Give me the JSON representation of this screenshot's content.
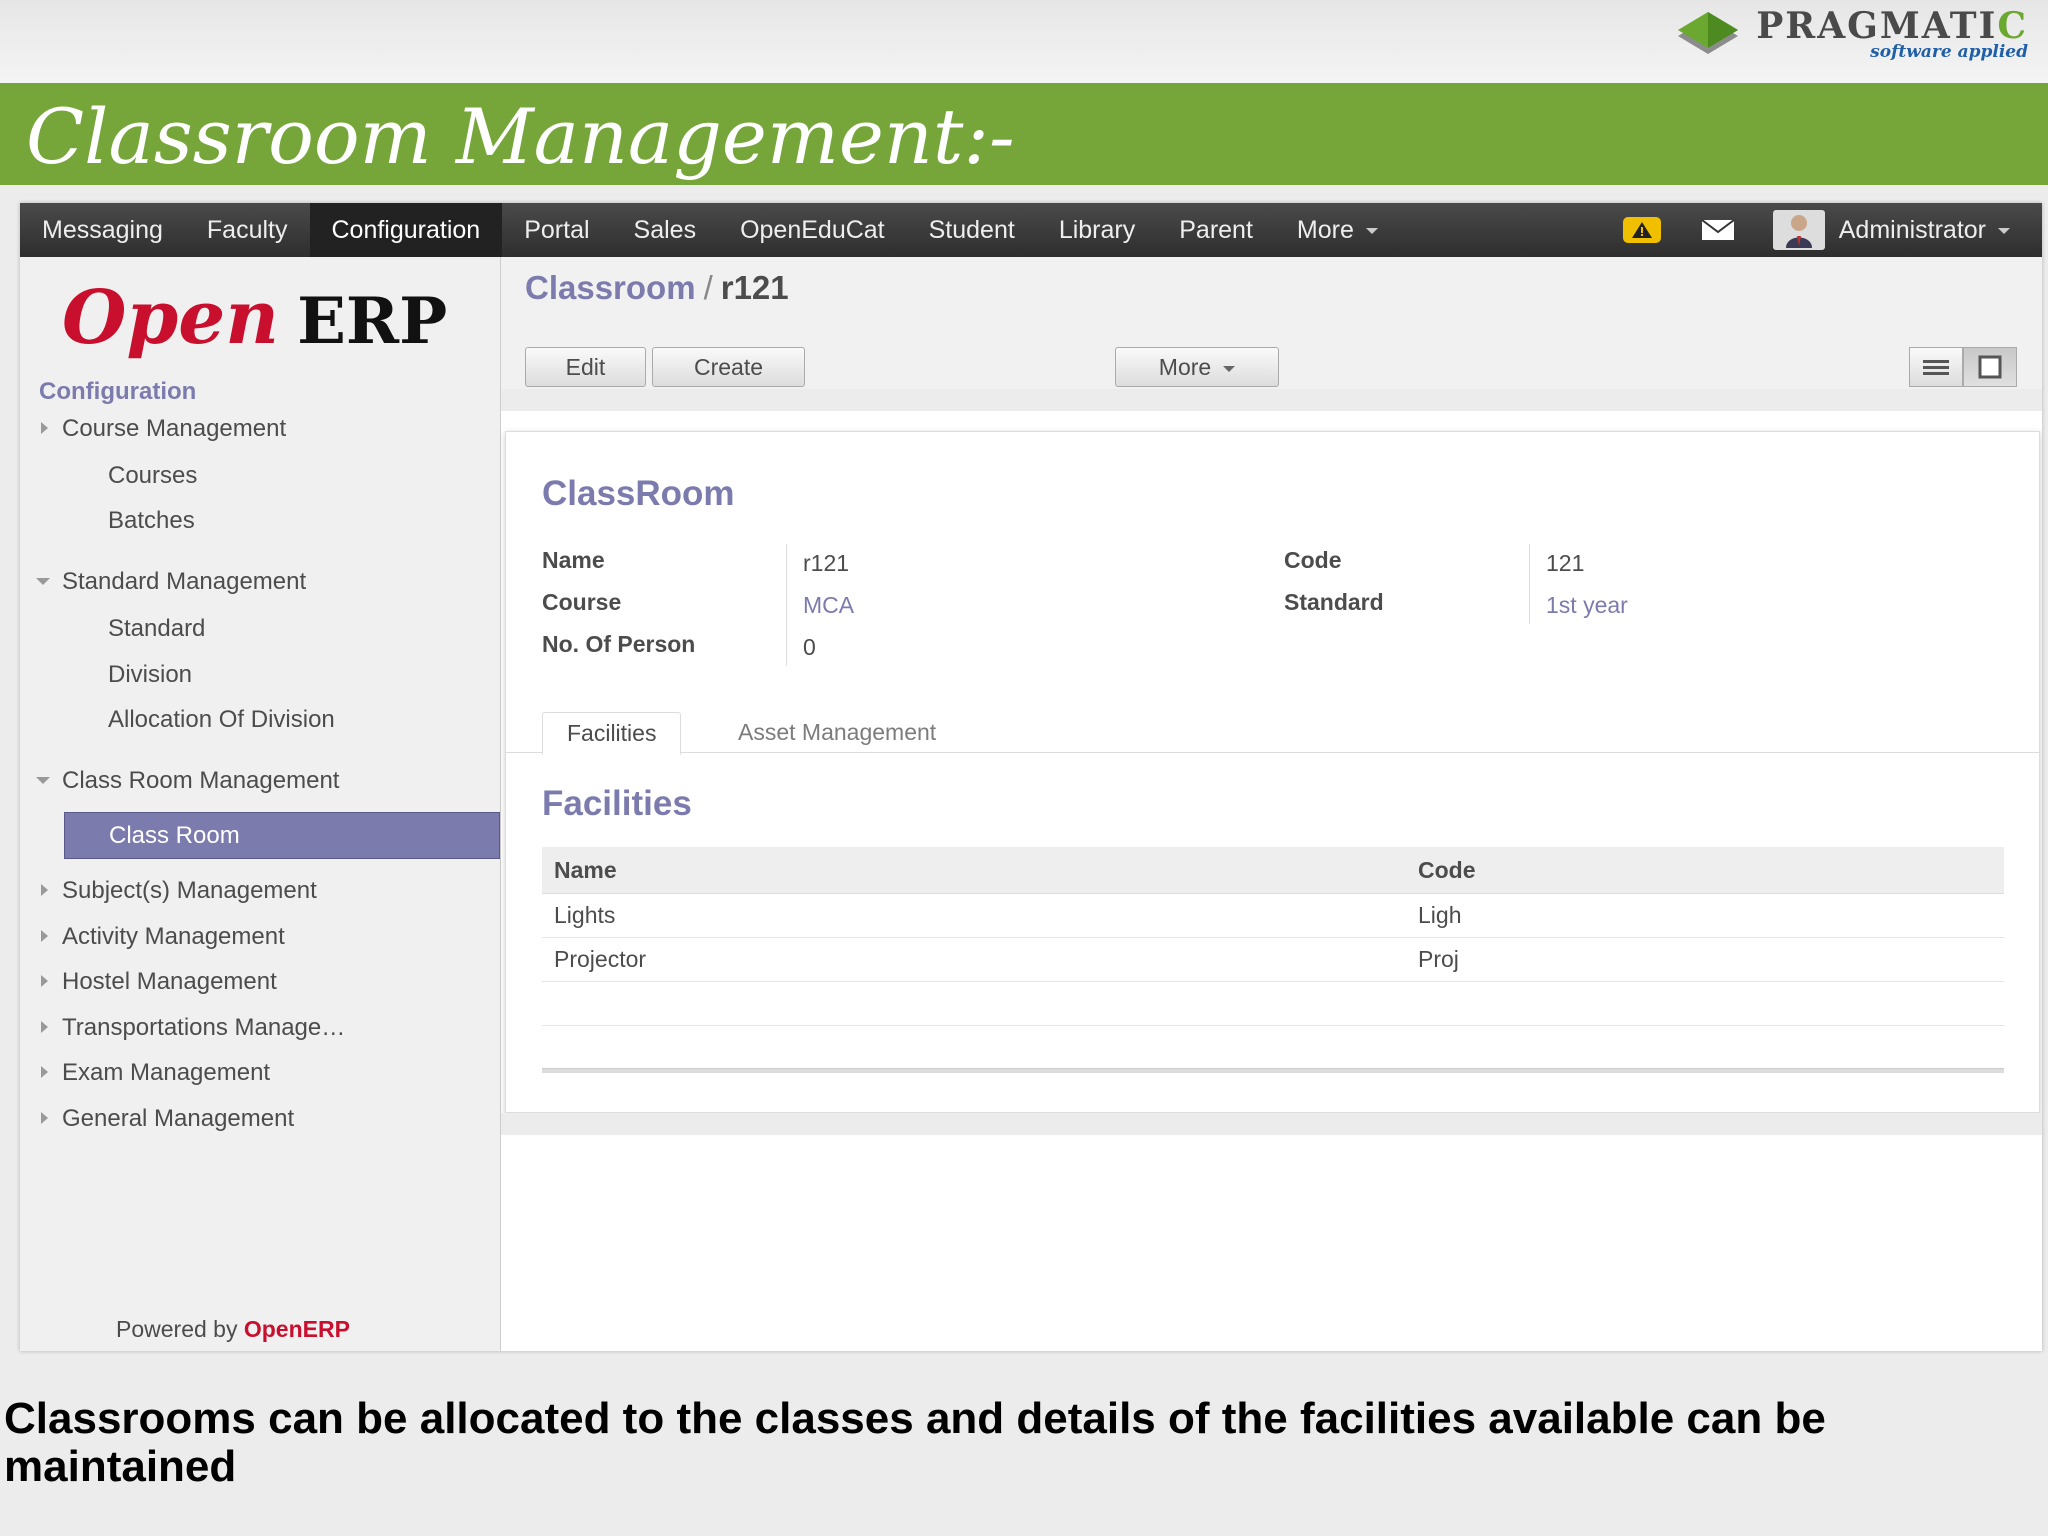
{
  "brand": {
    "name_main": "PRAGMATI",
    "name_end": "C",
    "tagline": "software applied"
  },
  "slide": {
    "title": "Classroom Management:-",
    "caption": "Classrooms can be allocated to the classes and details of the facilities available can be maintained"
  },
  "topbar": {
    "menu": [
      "Messaging",
      "Faculty",
      "Configuration",
      "Portal",
      "Sales",
      "OpenEduCat",
      "Student",
      "Library",
      "Parent"
    ],
    "more_label": "More",
    "user": "Administrator"
  },
  "sidebar": {
    "logo_open": "Open",
    "logo_erp": "ERP",
    "heading": "Configuration",
    "course_mgmt": "Course Management",
    "courses": "Courses",
    "batches": "Batches",
    "standard_mgmt": "Standard Management",
    "standard": "Standard",
    "division": "Division",
    "allocation": "Allocation Of Division",
    "classroom_mgmt": "Class Room Management",
    "classroom": "Class Room",
    "subject_mgmt": "Subject(s) Management",
    "activity_mgmt": "Activity Management",
    "hostel_mgmt": "Hostel Management",
    "transport_mgmt": "Transportations Manage…",
    "exam_mgmt": "Exam Management",
    "general_mgmt": "General Management",
    "powered_prefix": "Powered by",
    "powered_brand": "OpenERP"
  },
  "breadcrumb": {
    "parent": "Classroom",
    "sep": "/",
    "current": "r121"
  },
  "toolbar": {
    "edit": "Edit",
    "create": "Create",
    "more": "More"
  },
  "form": {
    "title": "ClassRoom",
    "name_label": "Name",
    "name_value": "r121",
    "course_label": "Course",
    "course_value": "MCA",
    "persons_label": "No. Of Person",
    "persons_value": "0",
    "code_label": "Code",
    "code_value": "121",
    "standard_label": "Standard",
    "standard_value": "1st year"
  },
  "tabs": {
    "facilities": "Facilities",
    "asset": "Asset Management"
  },
  "facilities": {
    "title": "Facilities",
    "headers": {
      "name": "Name",
      "code": "Code"
    },
    "rows": [
      {
        "name": "Lights",
        "code": "Ligh"
      },
      {
        "name": "Projector",
        "code": "Proj"
      }
    ]
  }
}
